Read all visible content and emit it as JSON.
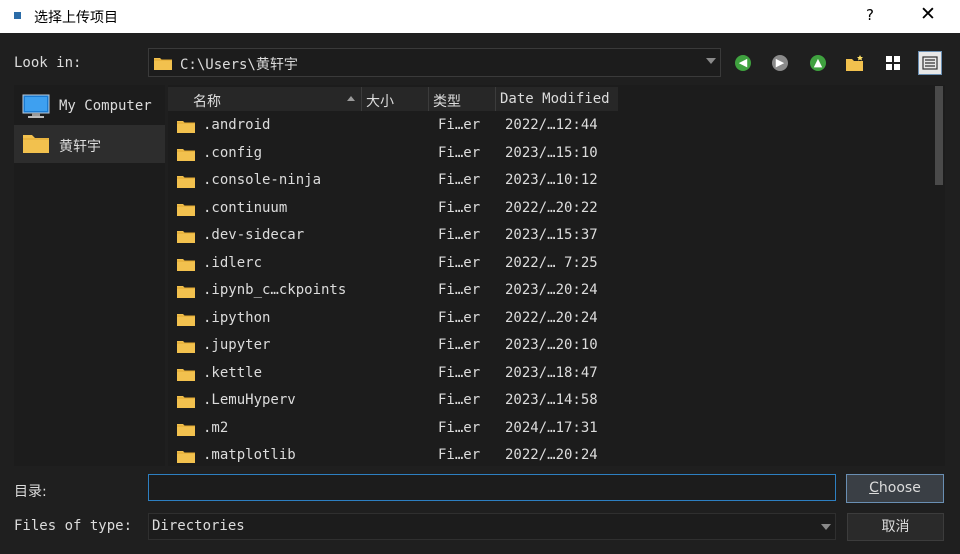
{
  "window": {
    "title": "选择上传项目",
    "help_label": "?",
    "close_label": "✕"
  },
  "toolbar": {
    "look_in_label": "Look in:",
    "path": "C:\\Users\\黄轩宇"
  },
  "sidebar": {
    "items": [
      {
        "label": "My Computer",
        "icon": "computer-icon"
      },
      {
        "label": "黄轩宇",
        "icon": "folder-icon",
        "selected": true
      }
    ]
  },
  "columns": [
    {
      "label": "名称",
      "sorted": "ascending"
    },
    {
      "label": "大小"
    },
    {
      "label": "类型"
    },
    {
      "label": "Date Modified"
    }
  ],
  "files": [
    {
      "name": ".android",
      "type": "Fi…er",
      "date": "2022/…12:44"
    },
    {
      "name": ".config",
      "type": "Fi…er",
      "date": "2023/…15:10"
    },
    {
      "name": ".console-ninja",
      "type": "Fi…er",
      "date": "2023/…10:12"
    },
    {
      "name": ".continuum",
      "type": "Fi…er",
      "date": "2022/…20:22"
    },
    {
      "name": ".dev-sidecar",
      "type": "Fi…er",
      "date": "2023/…15:37"
    },
    {
      "name": ".idlerc",
      "type": "Fi…er",
      "date": "2022/… 7:25"
    },
    {
      "name": ".ipynb_c…ckpoints",
      "type": "Fi…er",
      "date": "2023/…20:24"
    },
    {
      "name": ".ipython",
      "type": "Fi…er",
      "date": "2022/…20:24"
    },
    {
      "name": ".jupyter",
      "type": "Fi…er",
      "date": "2023/…20:10"
    },
    {
      "name": ".kettle",
      "type": "Fi…er",
      "date": "2023/…18:47"
    },
    {
      "name": ".LemuHyperv",
      "type": "Fi…er",
      "date": "2023/…14:58"
    },
    {
      "name": ".m2",
      "type": "Fi…er",
      "date": "2024/…17:31"
    },
    {
      "name": ".matplotlib",
      "type": "Fi…er",
      "date": "2022/…20:24"
    }
  ],
  "bottom": {
    "dir_label": "目录:",
    "dir_value": "",
    "choose_first": "C",
    "choose_rest": "hoose",
    "files_of_type_label": "Files of type:",
    "files_of_type_value": "Directories",
    "cancel_label": "取消"
  },
  "colors": {
    "background": "#1f1f1f",
    "panel": "#1c1c1c",
    "selected": "#2d2d2d",
    "focus": "#2d7fc1",
    "folder": "#f2c14e"
  }
}
